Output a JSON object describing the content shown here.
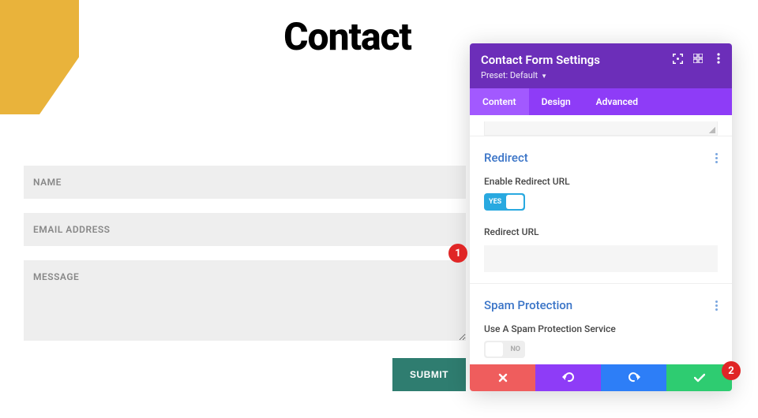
{
  "page": {
    "title": "Contact",
    "form": {
      "name_placeholder": "NAME",
      "email_placeholder": "EMAIL ADDRESS",
      "message_placeholder": "MESSAGE",
      "submit_label": "SUBMIT"
    }
  },
  "panel": {
    "title": "Contact Form Settings",
    "preset_prefix": "Preset: ",
    "preset_value": "Default",
    "tabs": {
      "content": "Content",
      "design": "Design",
      "advanced": "Advanced"
    },
    "redirect": {
      "heading": "Redirect",
      "enable_label": "Enable Redirect URL",
      "toggle_text": "YES",
      "url_label": "Redirect URL",
      "url_value": ""
    },
    "spam": {
      "heading": "Spam Protection",
      "use_service_label": "Use A Spam Protection Service",
      "toggle_text": "NO"
    }
  },
  "badges": {
    "b1": "1",
    "b2": "2"
  }
}
